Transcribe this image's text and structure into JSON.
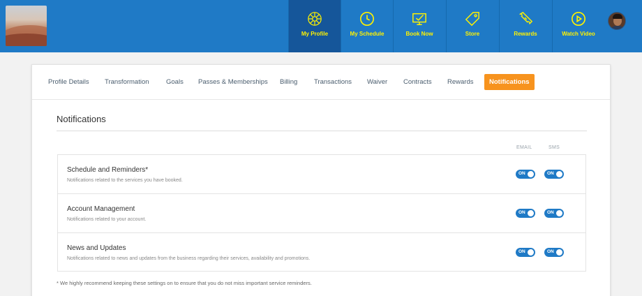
{
  "nav": {
    "items": [
      {
        "label": "My Profile",
        "icon": "profile-mandala-icon",
        "active": true
      },
      {
        "label": "My Schedule",
        "icon": "clock-icon",
        "active": false
      },
      {
        "label": "Book Now",
        "icon": "monitor-check-icon",
        "active": false
      },
      {
        "label": "Store",
        "icon": "price-tag-icon",
        "active": false
      },
      {
        "label": "Rewards",
        "icon": "ticket-icon",
        "active": false
      },
      {
        "label": "Watch Video",
        "icon": "play-icon",
        "active": false
      }
    ],
    "accent": "#fff200",
    "bar_color": "#1f7ac6"
  },
  "tabs": [
    "Profile Details",
    "Transformation",
    "Goals",
    "Passes & Memberships",
    "Billing",
    "Transactions",
    "Waiver",
    "Contracts",
    "Rewards",
    "Notifications"
  ],
  "active_tab": "Notifications",
  "active_tab_color": "#f7931e",
  "section": {
    "title": "Notifications",
    "col_email": "EMAIL",
    "col_sms": "SMS"
  },
  "rows": [
    {
      "title": "Schedule and Reminders*",
      "desc": "Notifications related to the services you have booked.",
      "email": "ON",
      "sms": "ON"
    },
    {
      "title": "Account Management",
      "desc": "Notifications related to your account.",
      "email": "ON",
      "sms": "ON"
    },
    {
      "title": "News and Updates",
      "desc": "Notifications related to news and updates from the business regarding their services, availability and promotions.",
      "email": "ON",
      "sms": "ON"
    }
  ],
  "footnote": "* We highly recommend keeping these settings on to ensure that you do not miss important service reminders."
}
